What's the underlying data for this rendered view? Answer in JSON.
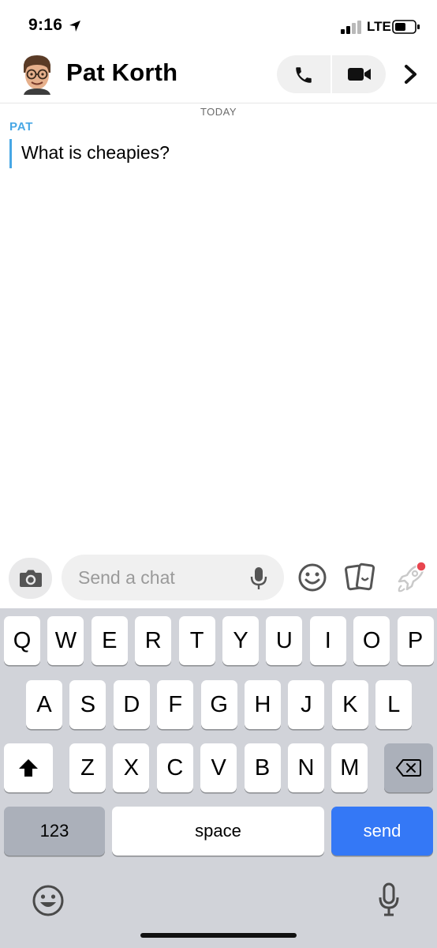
{
  "status_bar": {
    "time": "9:16",
    "network": "LTE"
  },
  "header": {
    "contact_name": "Pat Korth"
  },
  "chat": {
    "date_label": "TODAY",
    "messages": [
      {
        "sender": "PAT",
        "text": "What is cheapies?"
      }
    ]
  },
  "input": {
    "placeholder": "Send a chat"
  },
  "keyboard": {
    "row1": [
      "Q",
      "W",
      "E",
      "R",
      "T",
      "Y",
      "U",
      "I",
      "O",
      "P"
    ],
    "row2": [
      "A",
      "S",
      "D",
      "F",
      "G",
      "H",
      "J",
      "K",
      "L"
    ],
    "row3": [
      "Z",
      "X",
      "C",
      "V",
      "B",
      "N",
      "M"
    ],
    "numbers_label": "123",
    "space_label": "space",
    "send_label": "send"
  },
  "colors": {
    "accent_blue": "#47a7e5",
    "send_blue": "#3478f6",
    "notification_red": "#e8464f"
  },
  "icons": [
    "location-arrow-icon",
    "signal-icon",
    "battery-icon",
    "avatar",
    "phone-icon",
    "video-camera-icon",
    "chevron-right-icon",
    "camera-icon",
    "microphone-icon",
    "emoji-icon",
    "cards-icon",
    "rocket-icon",
    "shift-icon",
    "backspace-icon"
  ]
}
